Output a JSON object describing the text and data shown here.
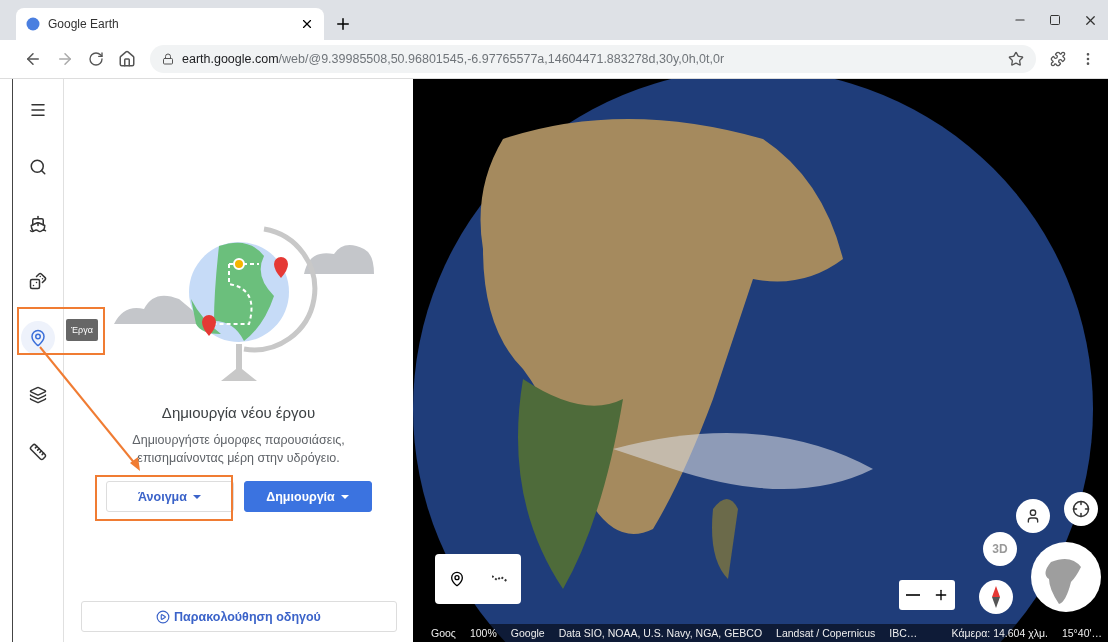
{
  "browser": {
    "tab_title": "Google Earth",
    "url_host": "earth.google.com",
    "url_path": "/web/@9.39985508,50.96801545,-6.97765577a,14604471.883278d,30y,0h,0t,0r"
  },
  "rail": [
    {
      "selected": false
    },
    {
      "selected": false
    },
    {
      "selected": false
    },
    {
      "selected": false
    },
    {
      "selected": true
    },
    {
      "selected": false
    },
    {
      "selected": false
    }
  ],
  "tooltip": "Έργα",
  "panel": {
    "title": "Δημιουργία νέου έργου",
    "description": "Δημιουργήστε όμορφες παρουσιάσεις, επισημαίνοντας μέρη στην υδρόγειο.",
    "buttons": [
      {
        "label": "Άνοιγμα",
        "kind": "outlined"
      },
      {
        "label": "Δημιουργία",
        "kind": "filled"
      }
    ],
    "guide": "Παρακολούθηση οδηγού"
  },
  "map": {
    "button_3d": "3D",
    "status_bar": [
      "Gooς",
      "100%",
      "Google",
      "Data SIO, NOAA, U.S. Navy, NGA, GEBCO",
      "Landsat / Copernicus",
      "IBC…",
      "Κάμερα: 14.604 χλμ.",
      "15°40'…"
    ]
  }
}
